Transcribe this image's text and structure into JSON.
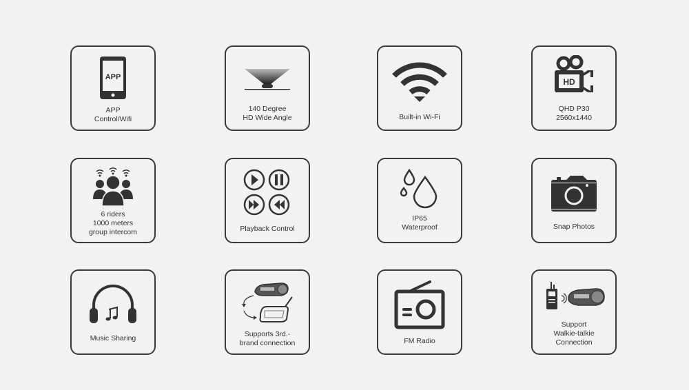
{
  "features": [
    {
      "id": "app-control",
      "icon": "smartphone-app-icon",
      "icon_text": "APP",
      "label": "APP\nControl/Wifi"
    },
    {
      "id": "wide-angle",
      "icon": "wide-angle-lens-icon",
      "label": "140 Degree\nHD Wide Angle"
    },
    {
      "id": "wifi",
      "icon": "wifi-icon",
      "label": "Built-in Wi-Fi"
    },
    {
      "id": "qhd-video",
      "icon": "video-camera-hd-icon",
      "icon_text": "HD",
      "label": "QHD P30\n2560x1440"
    },
    {
      "id": "group-intercom",
      "icon": "group-riders-icon",
      "label": "6 riders\n1000 meters\ngroup intercom"
    },
    {
      "id": "playback",
      "icon": "playback-controls-icon",
      "label": "Playback Control"
    },
    {
      "id": "waterproof",
      "icon": "water-drops-icon",
      "label": "IP65\nWaterproof"
    },
    {
      "id": "snap-photos",
      "icon": "camera-icon",
      "label": "Snap Photos"
    },
    {
      "id": "music-sharing",
      "icon": "headphones-icon",
      "label": "Music Sharing"
    },
    {
      "id": "third-brand",
      "icon": "device-exchange-icon",
      "label": "Supports 3rd.-\nbrand connection"
    },
    {
      "id": "fm-radio",
      "icon": "radio-icon",
      "label": "FM Radio"
    },
    {
      "id": "walkie-talkie",
      "icon": "walkie-talkie-icon",
      "label": "Support\nWalkie-talkie\nConnection"
    }
  ],
  "colors": {
    "background": "#f2f2f2",
    "border": "#3a3a3a",
    "icon": "#333333",
    "text": "#333333"
  }
}
